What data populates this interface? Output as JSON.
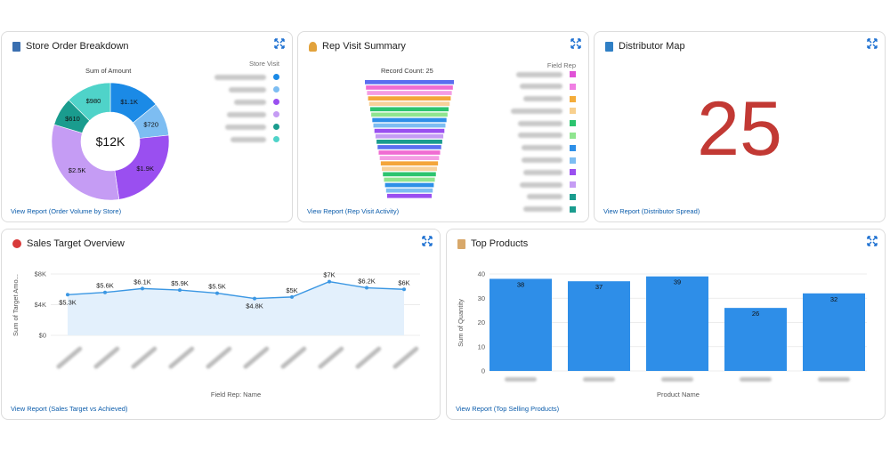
{
  "cards": {
    "store_order": {
      "title": "Store Order Breakdown",
      "icon": "store-icon",
      "chart_subtitle": "Sum of Amount",
      "legend_title": "Store Visit",
      "center_value": "$12K",
      "view_report": "View Report (Order Volume by Store)"
    },
    "rep_visit": {
      "title": "Rep Visit Summary",
      "icon": "walking-person-icon",
      "chart_subtitle": "Record Count: 25",
      "legend_title": "Field Rep",
      "view_report": "View Report (Rep Visit Activity)"
    },
    "distributor_map": {
      "title": "Distributor Map",
      "icon": "map-icon",
      "metric_value": "25",
      "view_report": "View Report (Distributor Spread)"
    },
    "sales_target": {
      "title": "Sales Target Overview",
      "icon": "target-icon",
      "view_report": "View Report (Sales Target vs Achieved)"
    },
    "top_products": {
      "title": "Top Products",
      "icon": "box-icon",
      "view_report": "View Report (Top Selling Products)"
    }
  },
  "colors": {
    "accent_link": "#0b5cab",
    "metric_red": "#c23934",
    "bar_blue": "#2e8ee8",
    "line_blue": "#3b97e3",
    "area_fill": "#e3f0fc"
  },
  "chart_data": [
    {
      "type": "pie",
      "title": "Sum of Amount",
      "legend_title": "Store Visit",
      "center_label": "$12K",
      "slices": [
        {
          "label": "$1.1K",
          "value": 1100,
          "color": "#1b8ae6"
        },
        {
          "label": "$720",
          "value": 720,
          "color": "#7dbdf2"
        },
        {
          "label": "$1.9K",
          "value": 1900,
          "color": "#9a4ff0"
        },
        {
          "label": "$2.5K",
          "value": 2500,
          "color": "#c59cf4"
        },
        {
          "label": "$610",
          "value": 610,
          "color": "#1a9c8e"
        },
        {
          "label": "$980",
          "value": 980,
          "color": "#4fd3c9"
        }
      ],
      "legend_colors": [
        "#1b8ae6",
        "#7dbdf2",
        "#9a4ff0",
        "#c59cf4",
        "#1a9c8e",
        "#4fd3c9"
      ]
    },
    {
      "type": "bar",
      "subtype": "funnel",
      "title": "Record Count: 25",
      "legend_title": "Field Rep",
      "stage_colors": [
        "#5b6ef0",
        "#f06cd2",
        "#f49ce3",
        "#f4a53a",
        "#f7d19a",
        "#2cc46e",
        "#8fe58f",
        "#2d8fe8",
        "#7dbdf2",
        "#9a4ff0",
        "#c59cf4",
        "#1a9c8e"
      ]
    },
    {
      "type": "line",
      "xlabel": "Field Rep: Name",
      "ylabel": "Sum of Target Amo...",
      "y_ticks": [
        "$8K",
        "$4K",
        "$0"
      ],
      "ylim": [
        0,
        8000
      ],
      "values": [
        5300,
        5600,
        6100,
        5900,
        5500,
        4800,
        5000,
        7000,
        6200,
        6000
      ],
      "labels": [
        "$5.3K",
        "$5.6K",
        "$6.1K",
        "$5.9K",
        "$5.5K",
        "$4.8K",
        "$5K",
        "$7K",
        "$6.2K",
        "$6K"
      ]
    },
    {
      "type": "bar",
      "xlabel": "Product Name",
      "ylabel": "Sum of Quantity",
      "y_ticks": [
        "40",
        "30",
        "20",
        "10",
        "0"
      ],
      "ylim": [
        0,
        40
      ],
      "values": [
        38,
        37,
        39,
        26,
        32
      ],
      "labels": [
        "38",
        "37",
        "39",
        "26",
        "32"
      ]
    }
  ]
}
